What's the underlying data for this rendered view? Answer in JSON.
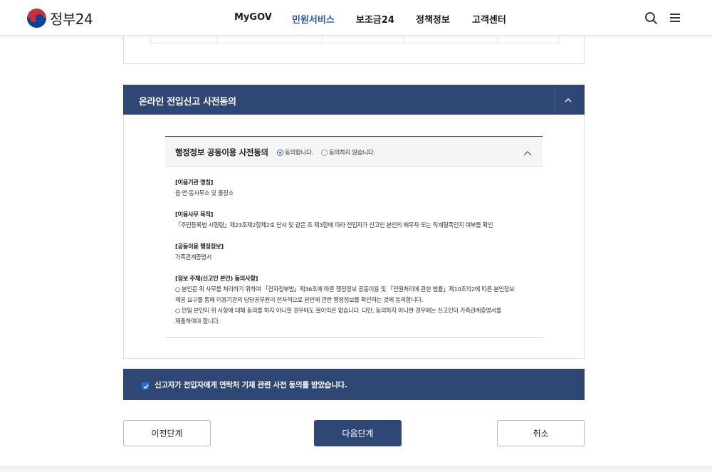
{
  "header": {
    "logo_text": "정부24",
    "nav": [
      {
        "label": "MyGOV",
        "active": false
      },
      {
        "label": "민원서비스",
        "active": true
      },
      {
        "label": "보조금24",
        "active": false
      },
      {
        "label": "정책정보",
        "active": false
      },
      {
        "label": "고객센터",
        "active": false
      }
    ],
    "icons": [
      "search-icon",
      "menu-icon"
    ]
  },
  "section": {
    "title": "온라인 전입신고 사전동의",
    "expanded": true
  },
  "consent": {
    "title": "행정정보 공동이용 사전동의",
    "agree_label": "동의합니다.",
    "disagree_label": "동의하지 않습니다.",
    "selected": "agree",
    "blocks": [
      {
        "title": "[이용기관 명칭]",
        "lines": [
          "읍·면·동사무소 및 출장소"
        ]
      },
      {
        "title": "[이용사무 목적]",
        "lines": [
          "「주민등록법 시행령」제23조제2항제2호 단서 및 같은 조 제3항에 따라 전입자가 신고인 본인의 배우자 또는 직계혈족인지 여부를 확인"
        ]
      },
      {
        "title": "[공동이용 행정정보]",
        "lines": [
          "가족관계증명서"
        ]
      },
      {
        "title": "[정보 주체(신고인 본인) 동의사항]",
        "lines": [
          "○ 본인은 위 사무를 처리하기 위하여 「전자정부법」제36조에 따른 행정정보 공동이용 및 「민원처리에 관한 법률」제10조의2에 따른 본인정보",
          "제공 요구를 통해 이용기관의 담당공무원이 전자적으로 본인에 관한 행정정보를 확인하는 것에 동의합니다.",
          "○ 만일 본인이 위 사항에 대해 동의를 하지 아니할 경우에도 불이익은 없습니다. 다만, 동의하지 아니한 경우에는 신고인이 가족관계증명서를",
          "제출하여야 합니다."
        ]
      }
    ]
  },
  "confirm": {
    "checked": true,
    "label": "신고자가 전입자에게 연락처 기재 관련 사전 동의를 받았습니다."
  },
  "buttons": {
    "prev": "이전단계",
    "next": "다음단계",
    "cancel": "취소"
  },
  "colors": {
    "navy": "#2f4775",
    "nav_active": "#2456b8",
    "radio_active": "#2a6bd1"
  }
}
